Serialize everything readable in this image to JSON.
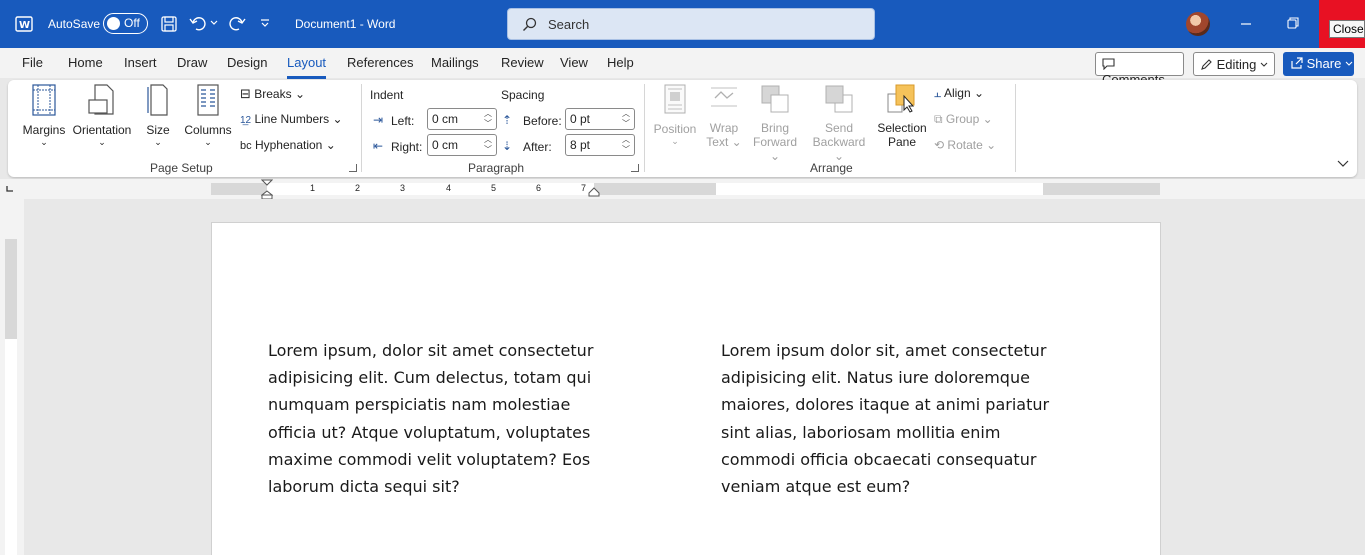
{
  "titlebar": {
    "autosave_label": "AutoSave",
    "autosave_state": "Off",
    "document_title": "Document1  -  Word",
    "search_placeholder": "Search",
    "close_tooltip": "Close",
    "accent": "#185abd"
  },
  "tabs": [
    "File",
    "Home",
    "Insert",
    "Draw",
    "Design",
    "Layout",
    "References",
    "Mailings",
    "Review",
    "View",
    "Help"
  ],
  "active_tab": "Layout",
  "tabs_right": {
    "comments": "Comments",
    "editing": "Editing",
    "share": "Share"
  },
  "ribbon": {
    "page_setup": {
      "margins": "Margins",
      "orientation": "Orientation",
      "size": "Size",
      "columns": "Columns",
      "breaks": "Breaks",
      "line_numbers": "Line Numbers",
      "hyphenation": "Hyphenation",
      "group_label": "Page Setup"
    },
    "paragraph": {
      "indent_header": "Indent",
      "spacing_header": "Spacing",
      "left_label": "Left:",
      "left_value": "0 cm",
      "right_label": "Right:",
      "right_value": "0 cm",
      "before_label": "Before:",
      "before_value": "0 pt",
      "after_label": "After:",
      "after_value": "8 pt",
      "group_label": "Paragraph"
    },
    "arrange": {
      "position": "Position",
      "wrap_text_1": "Wrap",
      "wrap_text_2": "Text",
      "bring_forward_1": "Bring",
      "bring_forward_2": "Forward",
      "send_backward_1": "Send",
      "send_backward_2": "Backward",
      "selection_pane_1": "Selection",
      "selection_pane_2": "Pane",
      "align": "Align",
      "group": "Group",
      "rotate": "Rotate",
      "group_label": "Arrange"
    }
  },
  "ruler": {
    "numbers": [
      "1",
      "2",
      "3",
      "4",
      "5",
      "6",
      "7"
    ]
  },
  "document": {
    "column1": "Lorem ipsum, dolor sit amet consectetur adipisicing elit. Cum delectus, totam qui numquam perspiciatis nam molestiae officia ut? Atque voluptatum, voluptates maxime commodi velit voluptatem? Eos laborum dicta sequi sit?",
    "column2": "Lorem ipsum dolor sit, amet consectetur adipisicing elit. Natus iure doloremque maiores, dolores itaque at animi pariatur sint alias, laboriosam mollitia enim commodi officia obcaecati consequatur veniam atque est eum?"
  }
}
